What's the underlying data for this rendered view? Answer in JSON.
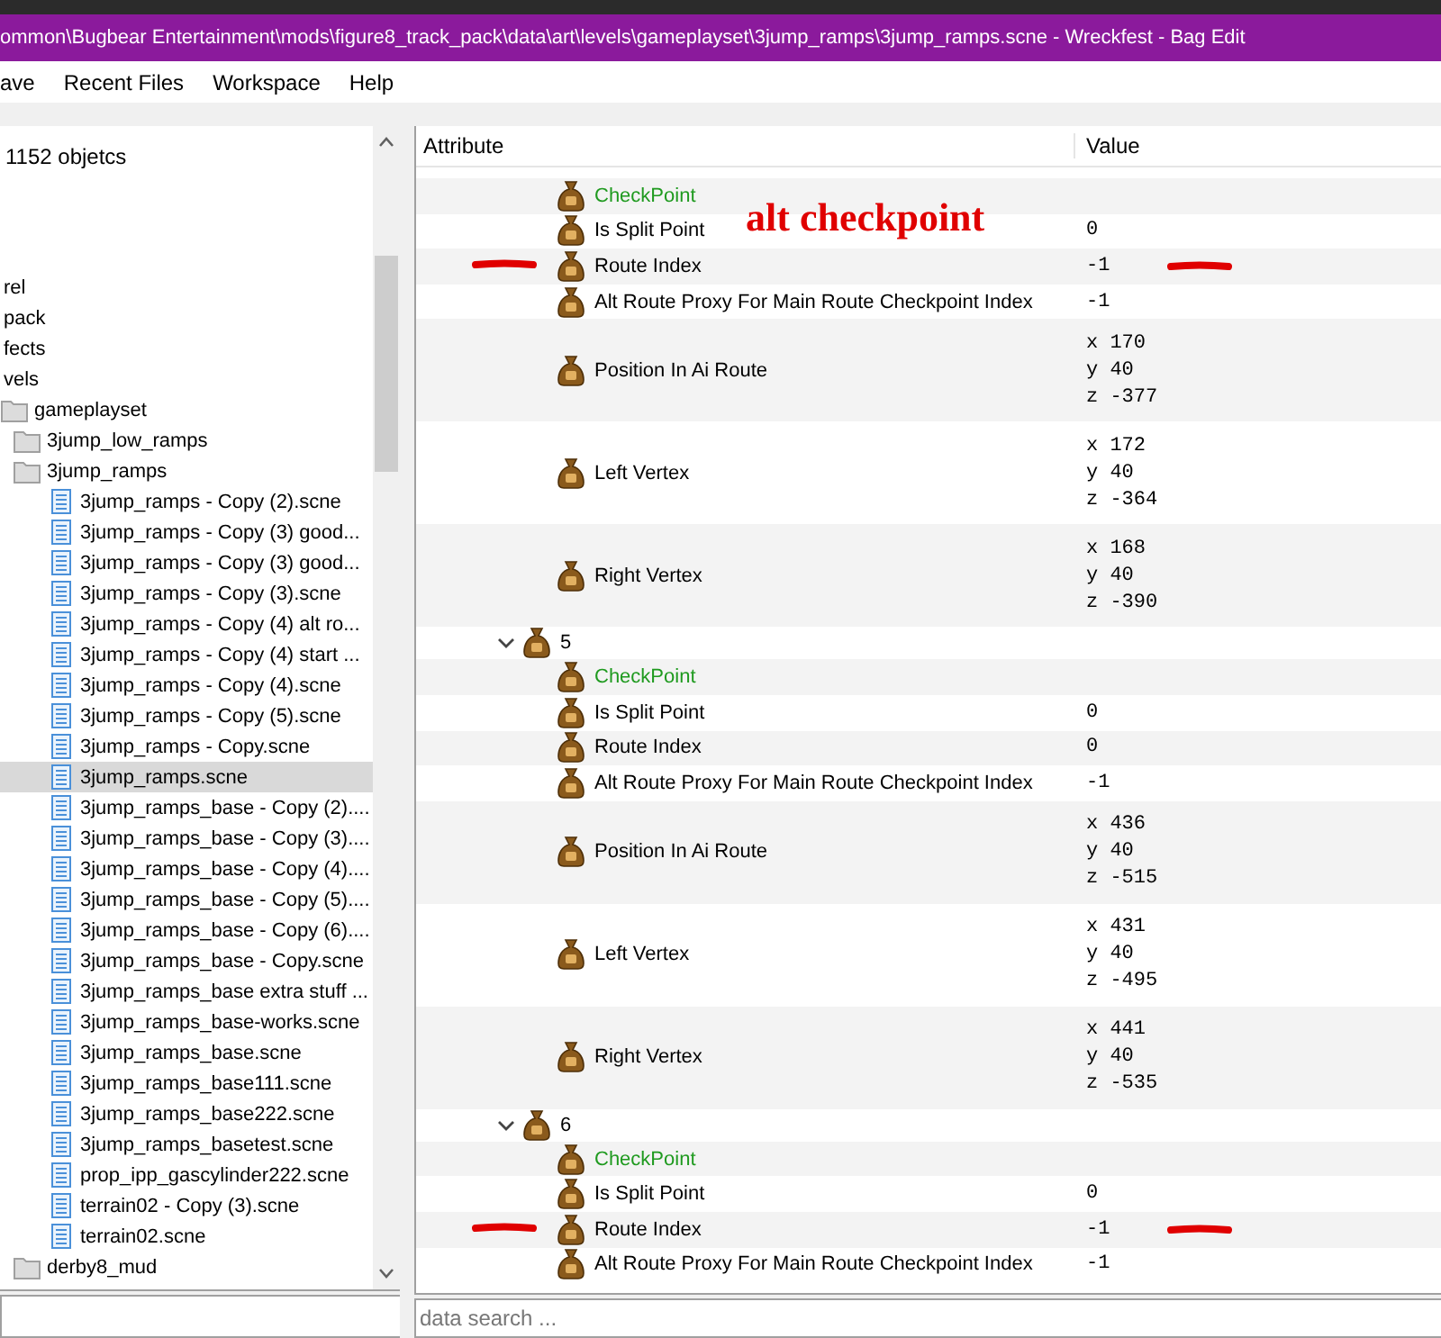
{
  "window": {
    "title": "ommon\\Bugbear Entertainment\\mods\\figure8_track_pack\\data\\art\\levels\\gameplayset\\3jump_ramps\\3jump_ramps.scne - Wreckfest - Bag Edit"
  },
  "menu": [
    "ave",
    "Recent Files",
    "Workspace",
    "Help"
  ],
  "file_tree": {
    "object_count": "1152 objetcs",
    "items": [
      {
        "label": "rel",
        "kind": "none",
        "selected": false
      },
      {
        "label": "pack",
        "kind": "none",
        "selected": false
      },
      {
        "label": "fects",
        "kind": "none",
        "selected": false
      },
      {
        "label": "vels",
        "kind": "none",
        "selected": false,
        "children": [
          {
            "label": "gameplayset",
            "kind": "folder",
            "selected": false,
            "children": [
              {
                "label": "3jump_low_ramps",
                "kind": "folder",
                "selected": false
              },
              {
                "label": "3jump_ramps",
                "kind": "folder",
                "selected": false,
                "children": [
                  {
                    "label": "3jump_ramps - Copy (2).scne",
                    "kind": "file",
                    "selected": false
                  },
                  {
                    "label": "3jump_ramps - Copy (3) good...",
                    "kind": "file",
                    "selected": false
                  },
                  {
                    "label": "3jump_ramps - Copy (3) good...",
                    "kind": "file",
                    "selected": false
                  },
                  {
                    "label": "3jump_ramps - Copy (3).scne",
                    "kind": "file",
                    "selected": false
                  },
                  {
                    "label": "3jump_ramps - Copy (4) alt ro...",
                    "kind": "file",
                    "selected": false
                  },
                  {
                    "label": "3jump_ramps - Copy (4) start ...",
                    "kind": "file",
                    "selected": false
                  },
                  {
                    "label": "3jump_ramps - Copy (4).scne",
                    "kind": "file",
                    "selected": false
                  },
                  {
                    "label": "3jump_ramps - Copy (5).scne",
                    "kind": "file",
                    "selected": false
                  },
                  {
                    "label": "3jump_ramps - Copy.scne",
                    "kind": "file",
                    "selected": false
                  },
                  {
                    "label": "3jump_ramps.scne",
                    "kind": "file",
                    "selected": true
                  },
                  {
                    "label": "3jump_ramps_base - Copy (2)....",
                    "kind": "file",
                    "selected": false
                  },
                  {
                    "label": "3jump_ramps_base - Copy (3)....",
                    "kind": "file",
                    "selected": false
                  },
                  {
                    "label": "3jump_ramps_base - Copy (4)....",
                    "kind": "file",
                    "selected": false
                  },
                  {
                    "label": "3jump_ramps_base - Copy (5)....",
                    "kind": "file",
                    "selected": false
                  },
                  {
                    "label": "3jump_ramps_base - Copy (6)....",
                    "kind": "file",
                    "selected": false
                  },
                  {
                    "label": "3jump_ramps_base - Copy.scne",
                    "kind": "file",
                    "selected": false
                  },
                  {
                    "label": "3jump_ramps_base extra stuff ...",
                    "kind": "file",
                    "selected": false
                  },
                  {
                    "label": "3jump_ramps_base-works.scne",
                    "kind": "file",
                    "selected": false
                  },
                  {
                    "label": "3jump_ramps_base.scne",
                    "kind": "file",
                    "selected": false
                  },
                  {
                    "label": "3jump_ramps_base111.scne",
                    "kind": "file",
                    "selected": false
                  },
                  {
                    "label": "3jump_ramps_base222.scne",
                    "kind": "file",
                    "selected": false
                  },
                  {
                    "label": "3jump_ramps_basetest.scne",
                    "kind": "file",
                    "selected": false
                  },
                  {
                    "label": "prop_ipp_gascylinder222.scne",
                    "kind": "file",
                    "selected": false
                  },
                  {
                    "label": "terrain02 - Copy (3).scne",
                    "kind": "file",
                    "selected": false
                  },
                  {
                    "label": "terrain02.scne",
                    "kind": "file",
                    "selected": false
                  }
                ]
              },
              {
                "label": "derby8_mud",
                "kind": "folder",
                "selected": false
              }
            ]
          }
        ]
      }
    ]
  },
  "attributes": {
    "columns": [
      "Attribute",
      "Value"
    ],
    "overlay_note": "alt checkpoint",
    "groups": [
      {
        "children": [
          {
            "kind": "class",
            "name": "CheckPoint"
          },
          {
            "kind": "attr",
            "name": "Is Split Point",
            "value": "0",
            "marked": false
          },
          {
            "kind": "attr",
            "name": "Route Index",
            "value": "-1",
            "marked": true
          },
          {
            "kind": "attr",
            "name": "Alt Route Proxy For Main Route Checkpoint Index",
            "value": "-1",
            "marked": false
          },
          {
            "kind": "vector",
            "name": "Position In Ai Route",
            "values": [
              "x 170",
              "y 40",
              "z -377"
            ],
            "marked": false
          },
          {
            "kind": "vector",
            "name": "Left Vertex",
            "values": [
              "x 172",
              "y 40",
              "z -364"
            ],
            "marked": false
          },
          {
            "kind": "vector",
            "name": "Right Vertex",
            "values": [
              "x 168",
              "y 40",
              "z -390"
            ],
            "marked": false
          }
        ]
      },
      {
        "label": "5",
        "expanded": true,
        "children": [
          {
            "kind": "class",
            "name": "CheckPoint"
          },
          {
            "kind": "attr",
            "name": "Is Split Point",
            "value": "0",
            "marked": false
          },
          {
            "kind": "attr",
            "name": "Route Index",
            "value": "0",
            "marked": false
          },
          {
            "kind": "attr",
            "name": "Alt Route Proxy For Main Route Checkpoint Index",
            "value": "-1",
            "marked": false
          },
          {
            "kind": "vector",
            "name": "Position In Ai Route",
            "values": [
              "x 436",
              "y 40",
              "z -515"
            ],
            "marked": false
          },
          {
            "kind": "vector",
            "name": "Left Vertex",
            "values": [
              "x 431",
              "y 40",
              "z -495"
            ],
            "marked": false
          },
          {
            "kind": "vector",
            "name": "Right Vertex",
            "values": [
              "x 441",
              "y 40",
              "z -535"
            ],
            "marked": false
          }
        ]
      },
      {
        "label": "6",
        "expanded": true,
        "children": [
          {
            "kind": "class",
            "name": "CheckPoint"
          },
          {
            "kind": "attr",
            "name": "Is Split Point",
            "value": "0",
            "marked": false
          },
          {
            "kind": "attr",
            "name": "Route Index",
            "value": "-1",
            "marked": true
          },
          {
            "kind": "attr",
            "name": "Alt Route Proxy For Main Route Checkpoint Index",
            "value": "-1",
            "marked": false
          }
        ]
      }
    ]
  },
  "search": {
    "placeholder": "data search ..."
  }
}
